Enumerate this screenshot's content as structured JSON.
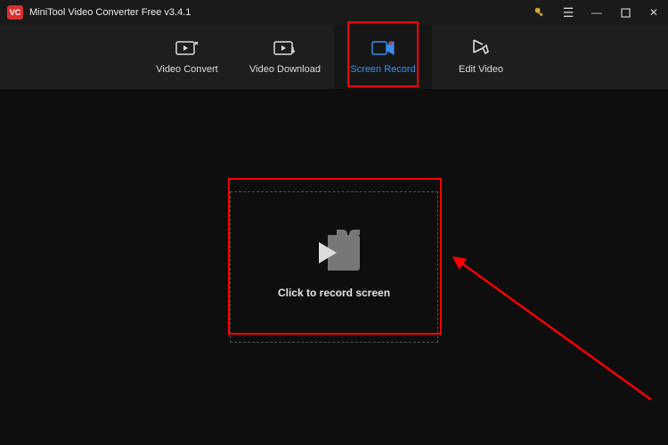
{
  "title": "MiniTool Video Converter Free v3.4.1",
  "tabs": {
    "t0": "Video Convert",
    "t1": "Video Download",
    "t2": "Screen Record",
    "t3": "Edit Video"
  },
  "main": {
    "cta": "Click to record screen"
  }
}
